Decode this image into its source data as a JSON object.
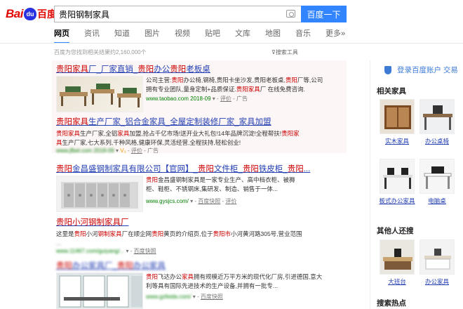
{
  "logo": {
    "part1": "Bai",
    "paw": "du",
    "part2": "百度"
  },
  "search": {
    "query": "贵阳钢制家具",
    "button": "百度一下"
  },
  "tabs": [
    {
      "label": "网页"
    },
    {
      "label": "资讯"
    },
    {
      "label": "知道"
    },
    {
      "label": "图片"
    },
    {
      "label": "视频"
    },
    {
      "label": "贴吧"
    },
    {
      "label": "文库"
    },
    {
      "label": "地图"
    },
    {
      "label": "音乐"
    },
    {
      "label": "更多»"
    }
  ],
  "result_count": "百度为您找到相关结果约2,160,000个",
  "search_tools": "搜索工具",
  "results": [
    {
      "title": [
        "贵阳家具",
        "厂_厂家直销_",
        "贵阳",
        "办公",
        "贵阳",
        "老板桌"
      ],
      "desc1": [
        "公司主营:",
        "贵阳",
        "办公椅,钢椅,贵阳卡坐沙发,贵阳老板桌,",
        "贵阳",
        "厂等,公司"
      ],
      "desc2": [
        "拥有专业团队,量身定制+品质保证.",
        "贵阳家具",
        "厂 在线免费咨询."
      ],
      "url": "www.taobao.com",
      "date": "2018-09",
      "review": "评价",
      "tag": "广告"
    },
    {
      "title": [
        "贵阳家具",
        "生产厂家_铝合金家具_全屋定制装修厂家_家具加盟"
      ],
      "desc1": [
        "贵阳家具",
        "生产厂家,全铝",
        "家具",
        "加盟,抢占千亿市场!送开业大礼包!14年品牌沉淀!全程帮扶!",
        "贵阳家"
      ],
      "desc2": [
        "具",
        "生产厂家,七大系列,千种风格,健康环保,灵活经营,全程扶持,轻松创业!"
      ],
      "url": "www.jfbel.com",
      "date": "2018-09",
      "vip": "V₃",
      "review": "评价",
      "tag": "广告"
    },
    {
      "title": [
        "贵阳",
        "金昌盛钢制家具有限公司【官网】_",
        "贵阳",
        "文件柜_",
        "贵阳",
        "铁皮柜_",
        "贵阳",
        "..."
      ],
      "desc1": [
        "贵阳",
        "金昌盛钢制家具是一家专业生产、高中档衣柜、被褥"
      ],
      "desc2": [
        "柜、鞋柜、不锈钢床,集研发、制造、销售于一体..."
      ],
      "url": "www.gysjcs.com/",
      "snapshot": "百度快照",
      "review": "评价"
    },
    {
      "title": [
        "贵阳",
        "小河",
        "钢制家具",
        "厂"
      ],
      "desc1": [
        "这里是",
        "贵阳",
        "小河",
        "钢制家具",
        "厂在顺企网",
        "贵阳",
        "黄页的介绍页,位于",
        "贵阳市",
        "小河黄河路305号,营业范围"
      ],
      "desc2": [
        "..."
      ],
      "url": "www.11467.com/guiyang/...",
      "snapshot": "百度快照"
    },
    {
      "title": [
        "贵阳",
        "办公家具厂_",
        "贵阳",
        "办公",
        "家具"
      ],
      "desc1": [
        "贵阳",
        "飞达办公",
        "家具",
        "拥有规模近万平方米的现代化厂房,引进德国,意大"
      ],
      "desc2": [
        "利等具有国际先进技术的生产设备,并拥有一批专..."
      ],
      "url": "www.gzfeida.com/",
      "snapshot": "百度快照"
    }
  ],
  "right": {
    "login": "登录百度账户 交易",
    "related_title": "相关家具",
    "related": [
      {
        "label": "实木家具"
      },
      {
        "label": "办公桌椅"
      },
      {
        "label": "板式办公家具"
      },
      {
        "label": "电脑桌"
      }
    ],
    "also_title": "其他人还搜",
    "also": [
      {
        "label": "大班台"
      },
      {
        "label": "办公家具"
      }
    ],
    "hot_title": "搜索热点"
  },
  "colors": {
    "brand_red": "#e10601",
    "brand_blue": "#2932e1",
    "button_blue": "#3385ff",
    "link_blue": "#2440b3",
    "highlight_red": "#cc0000",
    "url_green": "#008000"
  }
}
